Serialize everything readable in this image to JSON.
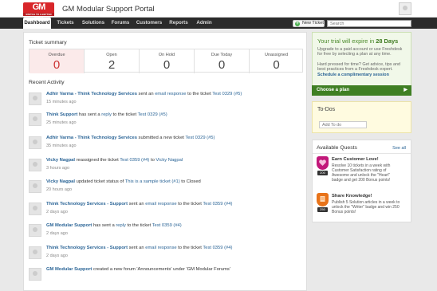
{
  "header": {
    "logo_text": "GM",
    "logo_tagline": "SWITCH TO A BETTER WORLD",
    "portal_title": "GM Modular Support Portal"
  },
  "nav": {
    "tabs": [
      "Dashboard",
      "Tickets",
      "Solutions",
      "Forums",
      "Customers",
      "Reports",
      "Admin"
    ],
    "active_tab": "Dashboard",
    "new_ticket_label": "New Ticket",
    "search_placeholder": "Search"
  },
  "ticket_summary": {
    "title": "Ticket summary",
    "cells": [
      {
        "label": "Overdue",
        "value": "0"
      },
      {
        "label": "Open",
        "value": "2"
      },
      {
        "label": "On Hold",
        "value": "0"
      },
      {
        "label": "Due Today",
        "value": "0"
      },
      {
        "label": "Unassigned",
        "value": "0"
      }
    ]
  },
  "recent_activity": {
    "title": "Recent Activity",
    "items": [
      {
        "actor": "Adhir Varma - Think Technology Services",
        "p1": " sent an ",
        "l1": "email response",
        "p2": " to the ticket ",
        "l2": "Test 0329 (#5)",
        "p3": "",
        "l3": "",
        "p4": "",
        "time": "15 minutes ago"
      },
      {
        "actor": "Think Support",
        "p1": " has sent a ",
        "l1": "reply",
        "p2": " to the ticket ",
        "l2": "Test 0329 (#5)",
        "p3": "",
        "l3": "",
        "p4": "",
        "time": "25 minutes ago"
      },
      {
        "actor": "Adhir Varma - Think Technology Services",
        "p1": " submitted a new ticket ",
        "l1": "Test 0329 (#5)",
        "p2": "",
        "l2": "",
        "p3": "",
        "l3": "",
        "p4": "",
        "time": "35 minutes ago"
      },
      {
        "actor": "Vicky Nagpal",
        "p1": " reassigned the ticket ",
        "l1": "Test 0359 (#4)",
        "p2": " to ",
        "l2": "Vicky Nagpal",
        "p3": "",
        "l3": "",
        "p4": "",
        "time": "3 hours ago"
      },
      {
        "actor": "Vicky Nagpal",
        "p1": " updated ticket status of ",
        "l1": "This is a sample ticket (#1)",
        "p2": " to Closed",
        "l2": "",
        "p3": "",
        "l3": "",
        "p4": "",
        "time": "20 hours ago"
      },
      {
        "actor": "Think Technology Services - Support",
        "p1": " sent an ",
        "l1": "email response",
        "p2": " to the ticket ",
        "l2": "Test 0359 (#4)",
        "p3": "",
        "l3": "",
        "p4": "",
        "time": "2 days ago"
      },
      {
        "actor": "GM Modular Support",
        "p1": " has sent a ",
        "l1": "reply",
        "p2": " to the ticket ",
        "l2": "Test 0359 (#4)",
        "p3": "",
        "l3": "",
        "p4": "",
        "time": "2 days ago"
      },
      {
        "actor": "Think Technology Services - Support",
        "p1": " sent an ",
        "l1": "email response",
        "p2": " to the ticket ",
        "l2": "Test 0359 (#4)",
        "p3": "",
        "l3": "",
        "p4": "",
        "time": "2 days ago"
      },
      {
        "actor": "GM Modular Support",
        "p1": " created a new forum 'Announcements' under 'GM Modular Forums'",
        "l1": "",
        "p2": "",
        "l2": "",
        "p3": "",
        "l3": "",
        "p4": "",
        "time": ""
      }
    ]
  },
  "trial": {
    "title_prefix": "Your trial will expire in ",
    "days": "28 Days",
    "upgrade_text_1": "Upgrade to a paid account or use Freshdesk",
    "upgrade_text_2": "for free by selecting a plan at any time.",
    "help_text_1": "Hard pressed for time? Get advice, tips and",
    "help_text_2": "best practices from a Freshdesk expert.",
    "session_link": "Schedule a complimentary session",
    "choose_plan": "Choose a plan",
    "arrow": "▶"
  },
  "todos": {
    "title": "To-Dos",
    "placeholder": "Add To do"
  },
  "quests": {
    "title": "Available Quests",
    "see_all": "See all",
    "items": [
      {
        "name": "Earn Customer Love!",
        "points": "200",
        "color": "#c2187a",
        "desc_1": "Resolve 10 tickets in a week with",
        "desc_2": "Customer Satisfaction rating of",
        "desc_3": "Awesome and unlock the \"Heart\"",
        "desc_4": "badge and get 200 Bonus points!"
      },
      {
        "name": "Share Knowledge!",
        "points": "250",
        "color": "#e8731a",
        "desc_1": "Publish 5 Solution articles in a week to",
        "desc_2": "unlock the \"Writer\" badge and win 250",
        "desc_3": "Bonus points!",
        "desc_4": ""
      }
    ]
  }
}
